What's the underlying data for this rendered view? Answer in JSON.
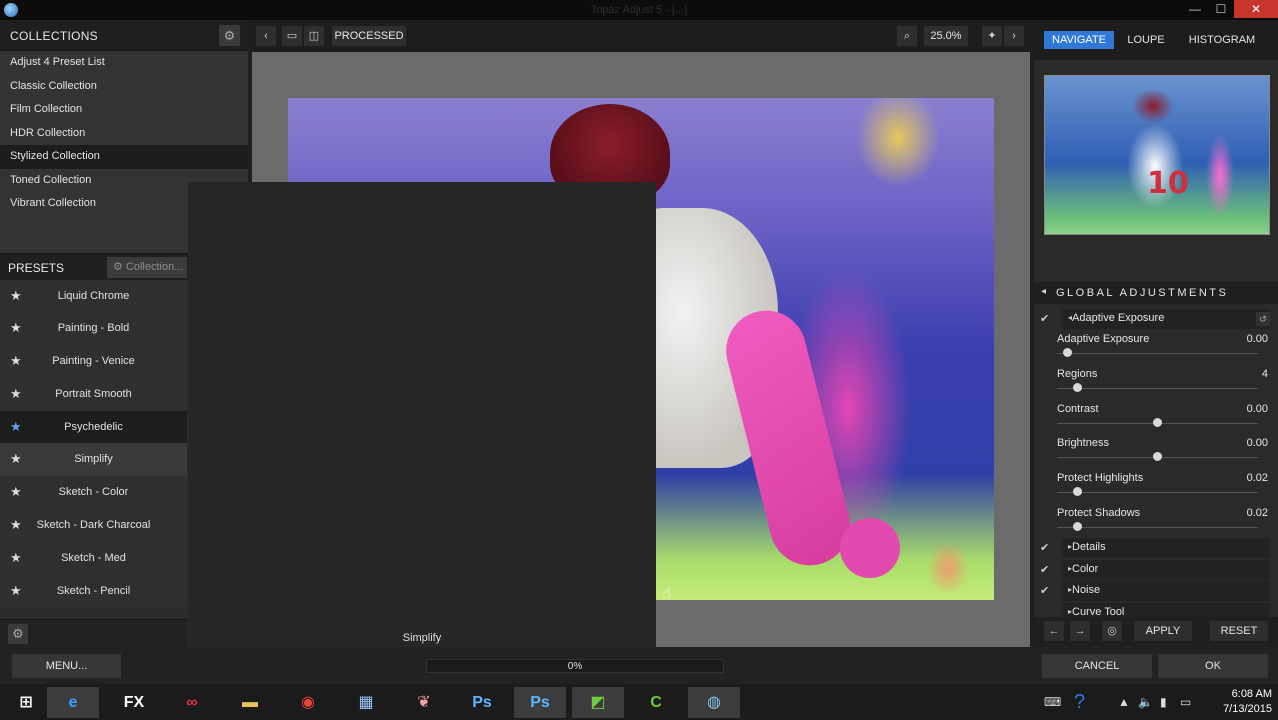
{
  "window": {
    "title": "Topaz Adjust 5 - [...]",
    "close_label": "✕",
    "min_label": "—",
    "max_label": "☐"
  },
  "collections": {
    "title": "COLLECTIONS",
    "items": [
      {
        "label": "Adjust 4 Preset List"
      },
      {
        "label": "Classic Collection"
      },
      {
        "label": "Film Collection"
      },
      {
        "label": "HDR Collection"
      },
      {
        "label": "Stylized Collection"
      },
      {
        "label": "Toned Collection"
      },
      {
        "label": "Vibrant Collection"
      }
    ],
    "selected_index": 4
  },
  "presets": {
    "title": "PRESETS",
    "collection_button": "Collection...",
    "items": [
      {
        "label": "Liquid Chrome"
      },
      {
        "label": "Painting - Bold"
      },
      {
        "label": "Painting - Venice"
      },
      {
        "label": "Portrait Smooth"
      },
      {
        "label": "Psychedelic"
      },
      {
        "label": "Simplify"
      },
      {
        "label": "Sketch - Color"
      },
      {
        "label": "Sketch - Dark Charcoal"
      },
      {
        "label": "Sketch - Med"
      },
      {
        "label": "Sketch - Pencil"
      }
    ],
    "active_index": 4,
    "hover_index": 5
  },
  "popup": {
    "caption": "Simplify"
  },
  "toolbar": {
    "processed_label": "PROCESSED",
    "zoom_value": "25.0%"
  },
  "navigator": {
    "tabs": [
      {
        "label": "NAVIGATE"
      },
      {
        "label": "LOUPE"
      },
      {
        "label": "HISTOGRAM"
      }
    ],
    "active_tab": 0,
    "jersey_number": "10"
  },
  "adjustments": {
    "title": "GLOBAL ADJUSTMENTS",
    "sections": {
      "adaptive_exposure": "Adaptive Exposure",
      "details": "Details",
      "color": "Color",
      "noise": "Noise",
      "curve_tool": "Curve Tool"
    },
    "sliders": [
      {
        "label": "Adaptive Exposure",
        "value": "0.00",
        "level": 0.05
      },
      {
        "label": "Regions",
        "value": "4",
        "level": 0.1
      },
      {
        "label": "Contrast",
        "value": "0.00",
        "level": 0.5
      },
      {
        "label": "Brightness",
        "value": "0.00",
        "level": 0.5
      },
      {
        "label": "Protect Highlights",
        "value": "0.02",
        "level": 0.1
      },
      {
        "label": "Protect Shadows",
        "value": "0.02",
        "level": 0.1
      }
    ],
    "apply_label": "APPLY",
    "reset_label": "RESET"
  },
  "bottom": {
    "menu_label": "MENU...",
    "progress_text": "0%",
    "progress_value": 0,
    "cancel_label": "CANCEL",
    "ok_label": "OK"
  },
  "taskbar": {
    "apps": [
      {
        "name": "windows-start-icon"
      },
      {
        "name": "internet-explorer-icon"
      },
      {
        "name": "fx-app-icon",
        "label": "FX"
      },
      {
        "name": "creative-cloud-icon"
      },
      {
        "name": "file-explorer-icon"
      },
      {
        "name": "chrome-icon"
      },
      {
        "name": "calculator-icon"
      },
      {
        "name": "brain-app-icon"
      },
      {
        "name": "photoshop-icon",
        "label": "Ps"
      },
      {
        "name": "photoshop-active-icon",
        "label": "Ps"
      },
      {
        "name": "camtasia-icon"
      },
      {
        "name": "camtasia-recorder-icon"
      },
      {
        "name": "globe-app-icon"
      }
    ],
    "time": "6:08 AM",
    "date": "7/13/2015"
  }
}
